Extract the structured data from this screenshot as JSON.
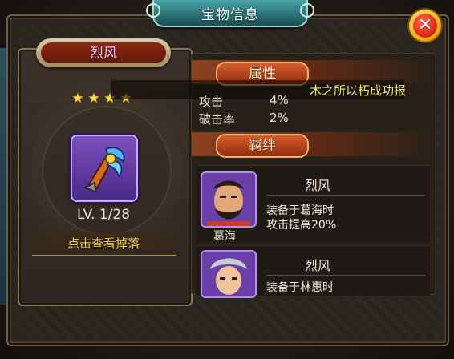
{
  "window": {
    "title": "宝物信息",
    "close_symbol": "✕"
  },
  "item": {
    "name": "烈风",
    "stars": 4,
    "level": "LV. 1/28",
    "drop_link": "点击查看掉落"
  },
  "sections": {
    "attributes": {
      "header": "属性",
      "tooltip": "木之所以朽成功报",
      "rows": [
        {
          "label": "攻击",
          "value": "4%"
        },
        {
          "label": "破击率",
          "value": "2%"
        }
      ]
    },
    "combos": {
      "header": "羁绊",
      "cards": [
        {
          "title": "烈风",
          "desc_line1": "装备于葛海时",
          "desc_line2": "攻击提高20%",
          "hero_name": "葛海"
        },
        {
          "title": "烈风",
          "desc_line1": "装备于林惠时",
          "desc_line2": ""
        }
      ]
    }
  },
  "colors": {
    "title_teal": "#2c7377",
    "accent_gold": "#ffd24a",
    "header_orange": "#d45e2c",
    "tooltip_yellow": "#f2e45c",
    "icon_purple": "#7c4fbf"
  },
  "icons": [
    "close-icon",
    "star-icon",
    "treasure-item-icon",
    "hero-portrait-icon"
  ]
}
